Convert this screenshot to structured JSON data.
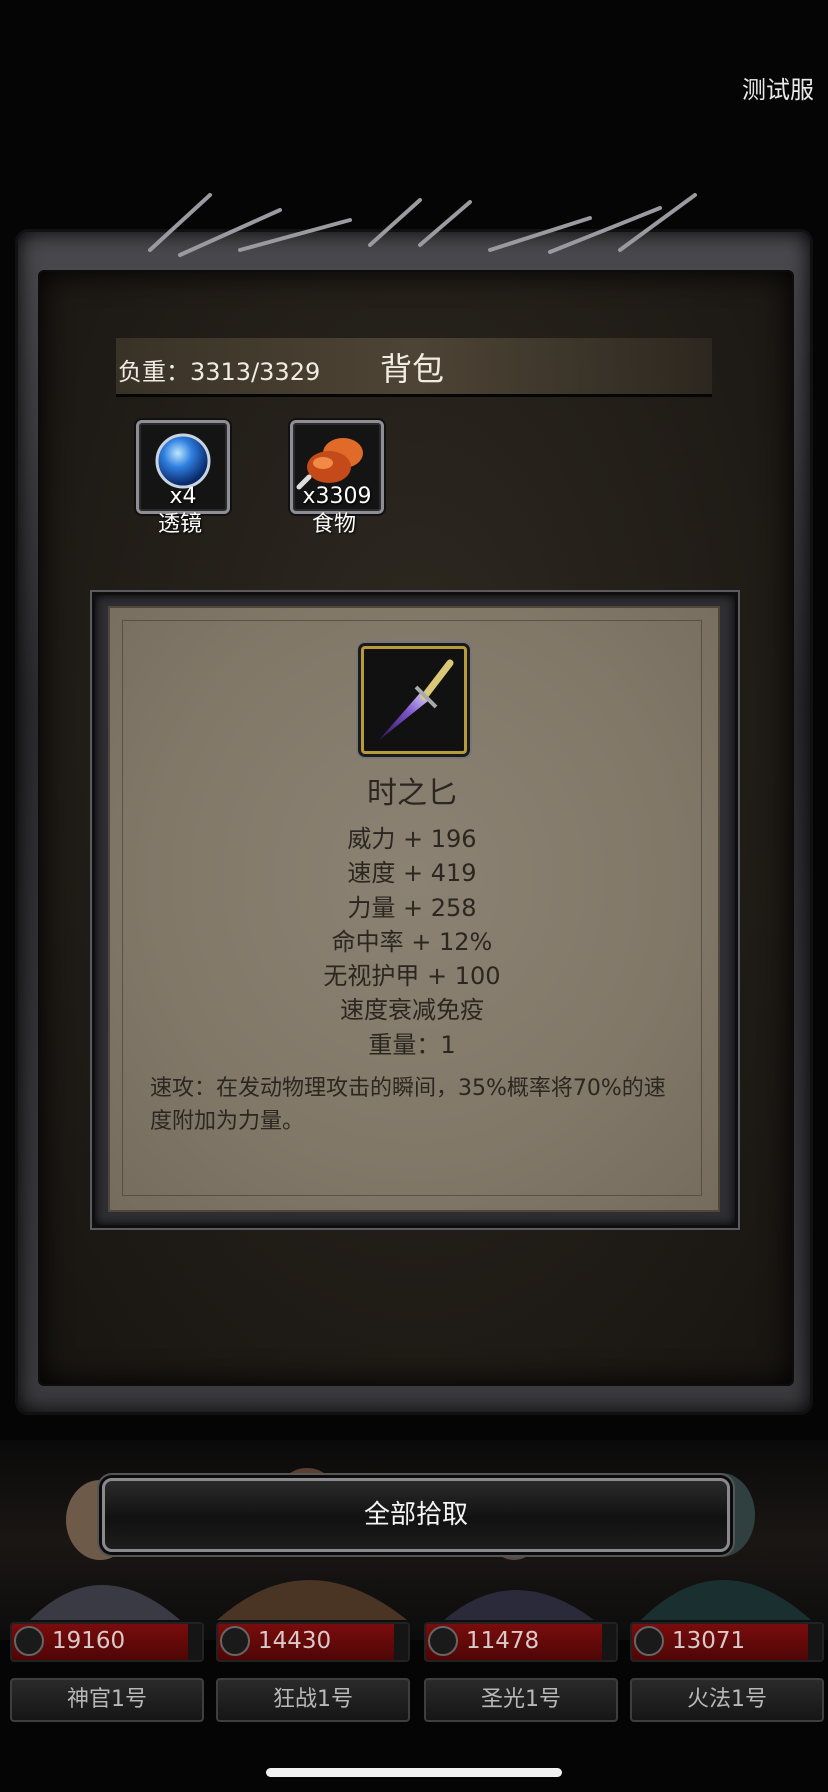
{
  "server_label": "测试服",
  "backpack": {
    "weight_label": "负重：3313/3329",
    "title": "背包",
    "items": [
      {
        "name": "透镜",
        "count": "x4",
        "icon": "blue-orb-icon"
      },
      {
        "name": "食物",
        "count": "x3309",
        "icon": "meat-icon"
      }
    ]
  },
  "detail": {
    "icon": "dagger-icon",
    "name": "时之匕",
    "stats": [
      "威力 + 196",
      "速度 + 419",
      "力量 + 258",
      "命中率 + 12%",
      "无视护甲 + 100",
      "速度衰减免疫",
      "重量：1"
    ],
    "description": "速攻：在发动物理攻击的瞬间，35%概率将70%的速度附加为力量。"
  },
  "pickup_button": "全部拾取",
  "heroes": [
    {
      "hp": "19160",
      "name": "神官1号"
    },
    {
      "hp": "14430",
      "name": "狂战1号"
    },
    {
      "hp": "11478",
      "name": "圣光1号"
    },
    {
      "hp": "13071",
      "name": "火法1号"
    }
  ],
  "colors": {
    "hp_bar": "#7a0c0c",
    "parchment": "#8c8273",
    "icon_gold_border": "#b89a3a"
  }
}
